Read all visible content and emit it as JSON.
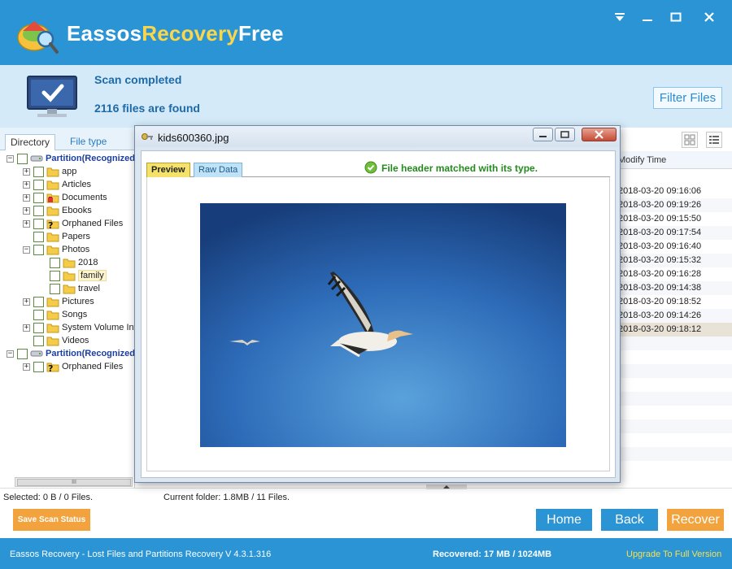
{
  "app": {
    "title_part1": "Eassos",
    "title_part2": "Recovery",
    "title_part3": "Free",
    "colors": {
      "primary": "#2a94d4",
      "accent_orange": "#f3a33e",
      "status_blue": "#1e6aa8"
    }
  },
  "window_controls": {
    "minimize": "minimize-icon",
    "maximize": "maximize-icon",
    "close": "close-icon",
    "menu": "menu-dropdown-icon"
  },
  "status": {
    "heading": "Scan completed",
    "files_found": "2116 files are found",
    "filter_button": "Filter Files"
  },
  "left": {
    "tabs": [
      {
        "label": "Directory"
      },
      {
        "label": "File type"
      }
    ],
    "tree": [
      {
        "label": "Partition(Recognized)",
        "icon": "drive-icon",
        "type": "partition",
        "expanded": true
      },
      {
        "label": "app",
        "icon": "folder-icon"
      },
      {
        "label": "Articles",
        "icon": "folder-icon"
      },
      {
        "label": "Documents",
        "icon": "folder-deleted-icon"
      },
      {
        "label": "Ebooks",
        "icon": "folder-icon"
      },
      {
        "label": "Orphaned Files",
        "icon": "folder-unknown-icon"
      },
      {
        "label": "Papers",
        "icon": "folder-icon"
      },
      {
        "label": "Photos",
        "icon": "folder-icon",
        "expanded": true
      },
      {
        "label": "2018",
        "icon": "folder-icon"
      },
      {
        "label": "family",
        "icon": "folder-icon",
        "selected": true
      },
      {
        "label": "travel",
        "icon": "folder-icon"
      },
      {
        "label": "Pictures",
        "icon": "folder-icon"
      },
      {
        "label": "Songs",
        "icon": "folder-icon"
      },
      {
        "label": "System Volume Information",
        "icon": "folder-icon"
      },
      {
        "label": "Videos",
        "icon": "folder-icon"
      },
      {
        "label": "Partition(Recognized)",
        "icon": "drive-icon",
        "type": "partition",
        "expanded": true
      },
      {
        "label": "Orphaned Files",
        "icon": "folder-unknown-icon"
      }
    ],
    "scrollbar_glyph": "III"
  },
  "right": {
    "column_header": "Modify Time",
    "times": [
      "2018-03-20 09:16:06",
      "2018-03-20 09:19:26",
      "2018-03-20 09:15:50",
      "2018-03-20 09:17:54",
      "2018-03-20 09:16:40",
      "2018-03-20 09:15:32",
      "2018-03-20 09:16:28",
      "2018-03-20 09:14:38",
      "2018-03-20 09:18:52",
      "2018-03-20 09:14:26",
      "2018-03-20 09:18:12"
    ]
  },
  "dialog": {
    "title": "kids600360.jpg",
    "tabs": [
      {
        "label": "Preview"
      },
      {
        "label": "Raw Data"
      }
    ],
    "match_message": "File header matched with its type.",
    "image_subject": "pelican-flying-photo"
  },
  "statusline": {
    "selected": "Selected: 0 B / 0 Files.",
    "current_folder": "Current folder: 1.8MB / 11 Files."
  },
  "buttons": {
    "save_scan": "Save Scan Status",
    "home": "Home",
    "back": "Back",
    "recover": "Recover"
  },
  "footer": {
    "product": "Eassos Recovery - Lost Files and Partitions Recovery",
    "version": "V 4.3.1.316",
    "recovered": "Recovered: 17 MB / 1024MB",
    "upgrade": "Upgrade To Full Version"
  }
}
